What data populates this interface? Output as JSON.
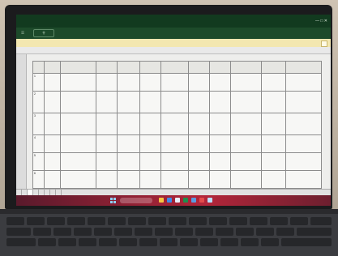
{
  "screen": {
    "window_title": "",
    "ribbon_search_placeholder": "",
    "info_bar_text": "",
    "formula_text": ""
  },
  "table": {
    "headers": [
      "",
      "",
      "",
      "",
      "",
      "",
      "",
      "",
      "",
      "",
      "",
      ""
    ],
    "rows": [
      [
        "1",
        "",
        "",
        "",
        "",
        "",
        "",
        "",
        "",
        "",
        "",
        ""
      ],
      [
        "2",
        "",
        "",
        "",
        "",
        "",
        "",
        "",
        "",
        "",
        "",
        ""
      ],
      [
        "3",
        "",
        "",
        "",
        "",
        "",
        "",
        "",
        "",
        "",
        "",
        ""
      ],
      [
        "4",
        "",
        "",
        "",
        "",
        "",
        "",
        "",
        "",
        "",
        "",
        ""
      ],
      [
        "5",
        "",
        "",
        "",
        "",
        "",
        "",
        "",
        "",
        "",
        "",
        ""
      ],
      [
        "6",
        "",
        "",
        "",
        "",
        "",
        "",
        "",
        "",
        "",
        "",
        ""
      ]
    ]
  },
  "sheet_tabs": [
    "",
    "",
    "",
    "",
    "",
    "",
    "",
    ""
  ],
  "taskbar": {
    "weather": "",
    "search_label": "",
    "clock_time": "",
    "clock_date": ""
  },
  "colors": {
    "title_bar": "#123a1f",
    "taskbar_accent": "#b3263a",
    "info_bar": "#f3e7b0"
  },
  "icons": [
    "start-icon",
    "search-icon",
    "file-explorer-icon",
    "browser-icon",
    "mail-icon",
    "excel-icon",
    "store-icon"
  ]
}
